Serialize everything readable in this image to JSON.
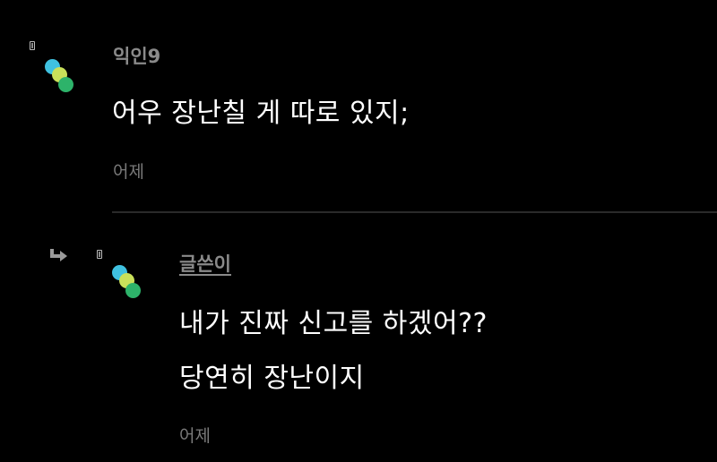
{
  "comments": [
    {
      "author": "익인9",
      "lines": [
        "어우 장난칠 게 따로 있지;"
      ],
      "time": "어제"
    },
    {
      "author": "글쓴이",
      "lines": [
        "내가 진짜 신고를 하겠어??",
        "당연히 장난이지"
      ],
      "time": "어제"
    }
  ],
  "icons": {
    "reply": "reply-arrow-icon",
    "marker": "bookmark-icon",
    "avatar": "three-dot-avatar-icon"
  },
  "colors": {
    "background": "#000000",
    "text": "#ffffff",
    "author": "#8a8a8a",
    "timestamp": "#7a7a7a",
    "avatar_dots": [
      "#3fc1e0",
      "#c9e05a",
      "#2db36a"
    ]
  }
}
